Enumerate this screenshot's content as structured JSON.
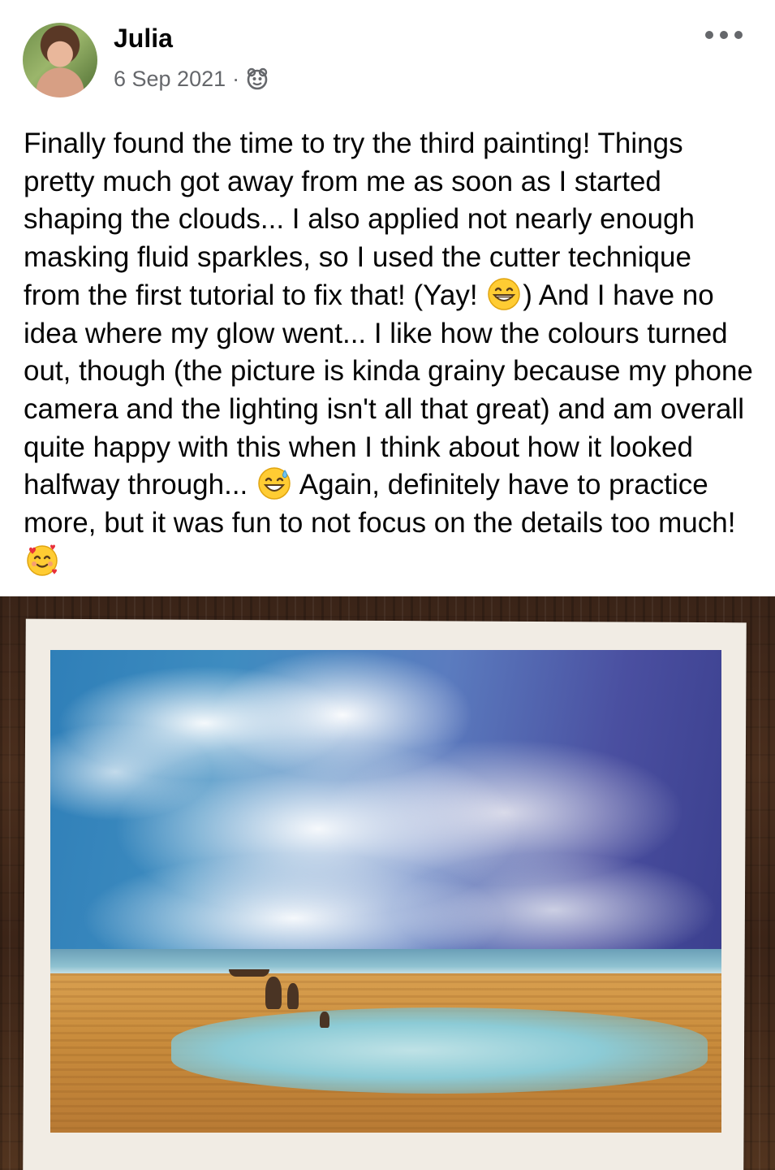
{
  "post": {
    "author": "Julia",
    "date": "6 Sep 2021",
    "separator": "·",
    "audience_icon": "friends-icon",
    "more_icon": "more-options-icon",
    "text_parts": [
      "Finally found the time to try the third painting! Things pretty much got away from me as soon as I started shaping the clouds... I also applied not nearly enough masking fluid sparkles, so I used the cutter technique from the first tutorial to fix that! (Yay! ",
      ") And I have no idea where my glow went... I like how the colours turned out, though (the picture is kinda grainy because my phone camera and the lighting isn't all that great) and am overall quite happy with this when I think about how it looked halfway through... ",
      " Again, definitely have to practice more, but it was fun to not focus on the details too much! "
    ],
    "emojis": [
      "grinning-emoji",
      "sweat-smile-emoji",
      "smiling-hearts-emoji"
    ]
  },
  "photo": {
    "subject": "watercolor-beach-painting"
  }
}
